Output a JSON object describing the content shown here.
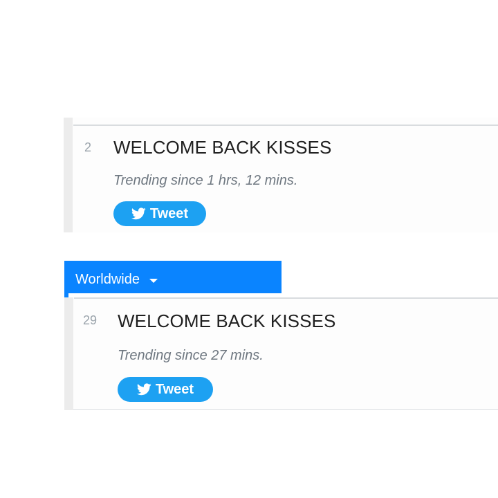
{
  "trends": [
    {
      "rank": "2",
      "name": "WELCOME BACK KISSES",
      "since": "Trending since 1 hrs, 12 mins.",
      "tweet_label": "Tweet"
    },
    {
      "rank": "29",
      "name": "WELCOME BACK KISSES",
      "since": "Trending since 27 mins.",
      "tweet_label": "Tweet"
    }
  ],
  "location": {
    "label": "Worldwide",
    "icon": "caret-down-icon"
  },
  "colors": {
    "accent": "#0a84ff",
    "tweet_button": "#1da1f2",
    "title_text": "#1f1f1f",
    "muted_text": "#6e7780",
    "rank_text": "#9aa3ab"
  }
}
